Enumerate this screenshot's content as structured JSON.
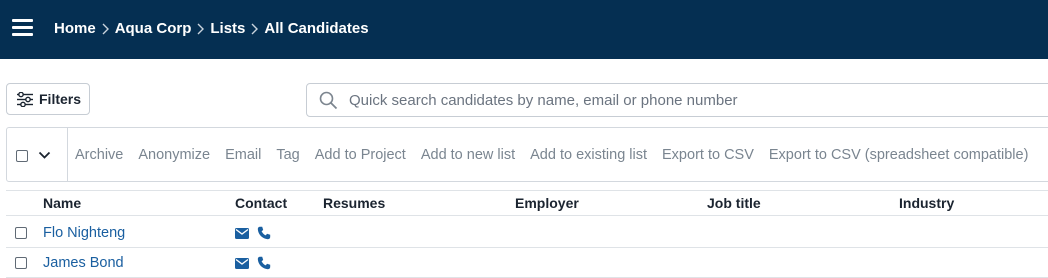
{
  "header": {
    "breadcrumb": [
      "Home",
      "Aqua Corp",
      "Lists",
      "All Candidates"
    ]
  },
  "toolbar": {
    "filters_label": "Filters",
    "search_placeholder": "Quick search candidates by name, email or phone number"
  },
  "actions": [
    "Archive",
    "Anonymize",
    "Email",
    "Tag",
    "Add to Project",
    "Add to new list",
    "Add to existing list",
    "Export to CSV",
    "Export to CSV (spreadsheet compatible)"
  ],
  "table": {
    "columns": [
      "Name",
      "Contact",
      "Resumes",
      "Employer",
      "Job title",
      "Industry"
    ],
    "rows": [
      {
        "name": "Flo Nighteng",
        "contact_icons": [
          "envelope-icon",
          "phone-icon"
        ]
      },
      {
        "name": "James Bond",
        "contact_icons": [
          "envelope-icon",
          "phone-icon"
        ]
      }
    ]
  },
  "colors": {
    "topbar": "#052f52",
    "link": "#1a5fa0",
    "action_text": "#7a8590"
  }
}
